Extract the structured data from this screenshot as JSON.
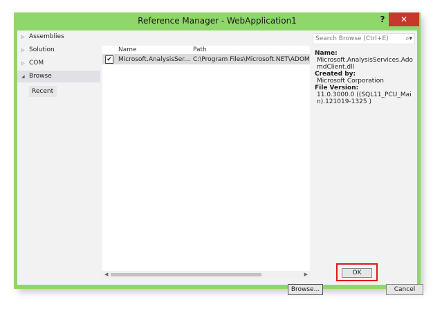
{
  "window": {
    "title": "Reference Manager - WebApplication1",
    "help_label": "?",
    "close_label": "✕"
  },
  "nav": {
    "items": [
      {
        "label": "Assemblies",
        "arrow": "▷"
      },
      {
        "label": "Solution",
        "arrow": "▷"
      },
      {
        "label": "COM",
        "arrow": "▷"
      },
      {
        "label": "Browse",
        "arrow": "◢"
      }
    ],
    "sub_item": "Recent"
  },
  "search": {
    "placeholder": "Search Browse (Ctrl+E)",
    "icon": "⌕▾"
  },
  "table": {
    "columns": [
      "Name",
      "Path"
    ],
    "rows": [
      {
        "checked": "✔",
        "name": "Microsoft.AnalysisSer...",
        "path": "C:\\Program Files\\Microsoft.NET\\ADOMD"
      }
    ],
    "scroll_left": "◀",
    "scroll_right": "▶"
  },
  "details": {
    "name_label": "Name:",
    "name_value": "Microsoft.AnalysisServices.AdomdClient.dll",
    "created_label": "Created by:",
    "created_value": "Microsoft Corporation",
    "version_label": "File Version:",
    "version_value": "11.0.3000.0 ((SQL11_PCU_Main).121019-1325 )"
  },
  "buttons": {
    "browse": "Browse...",
    "ok": "OK",
    "cancel": "Cancel"
  }
}
